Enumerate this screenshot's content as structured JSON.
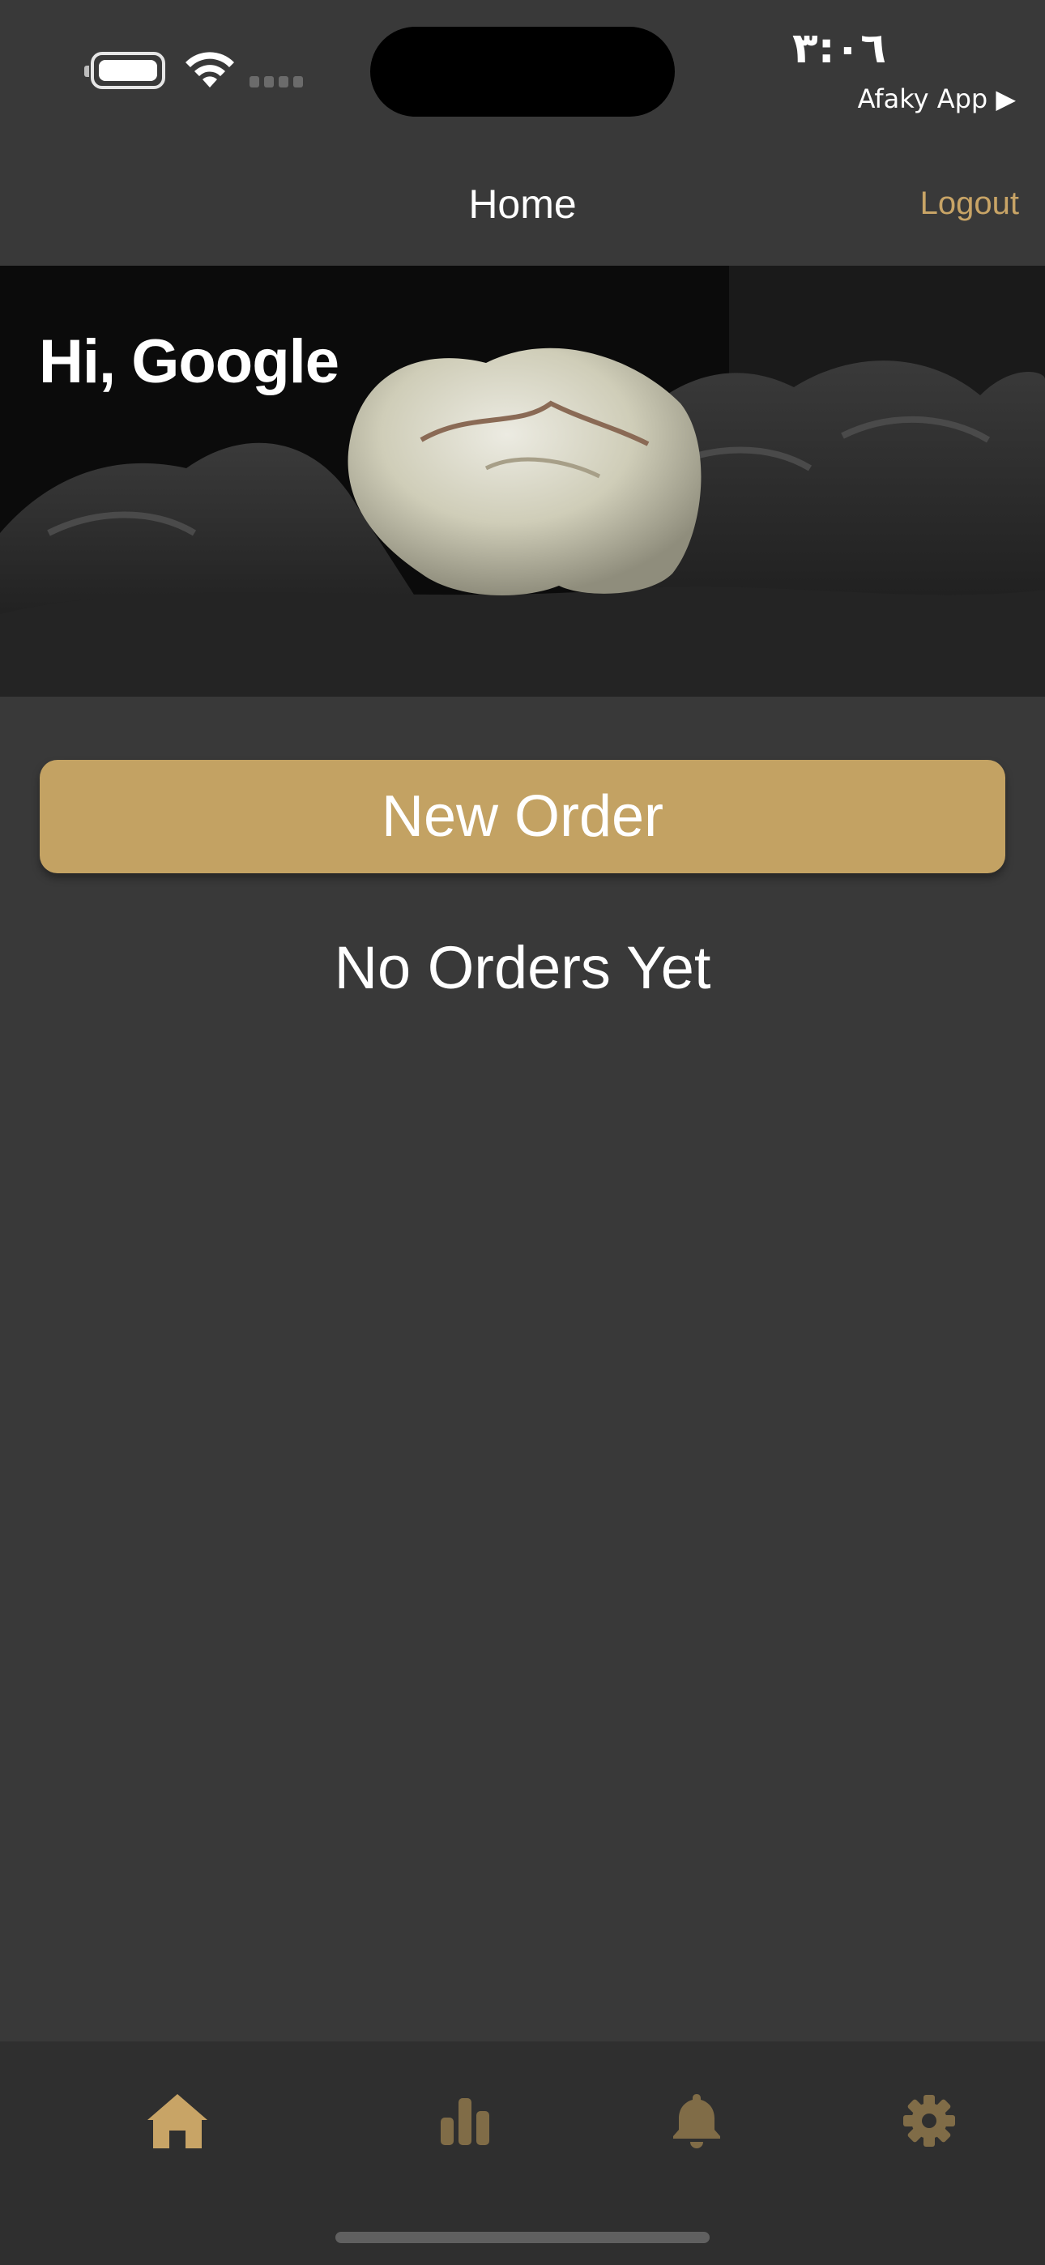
{
  "status_bar": {
    "time": "٣:٠٦",
    "back_app": "Afaky App ▶"
  },
  "navbar": {
    "title": "Home",
    "logout_label": "Logout"
  },
  "hero": {
    "greeting": "Hi, Google"
  },
  "main": {
    "new_order_label": "New Order",
    "empty_state": "No Orders Yet"
  },
  "tab_bar": {
    "items": [
      {
        "icon": "home-icon",
        "active": true
      },
      {
        "icon": "bar-chart-icon",
        "active": false
      },
      {
        "icon": "bell-icon",
        "active": false
      },
      {
        "icon": "gear-icon",
        "active": false
      }
    ]
  },
  "colors": {
    "background": "#393939",
    "accent": "#c3a263",
    "tab_active": "#c8a466",
    "tab_inactive": "#806c47",
    "tab_bar": "#2f2f2f"
  }
}
